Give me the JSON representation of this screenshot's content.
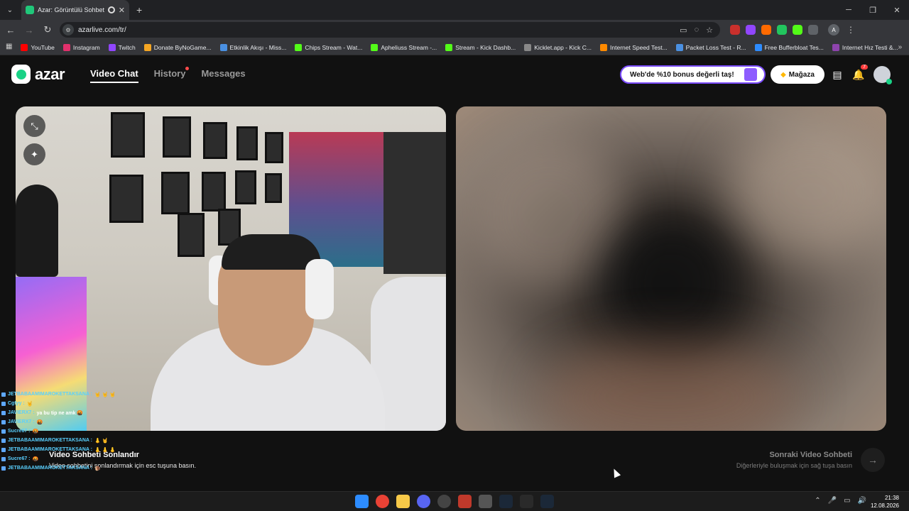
{
  "browser": {
    "tab_title": "Azar: Görüntülü Sohbet & V",
    "url": "azarlive.com/tr/",
    "bookmarks": [
      {
        "label": "YouTube",
        "color": "#ff0000"
      },
      {
        "label": "Instagram",
        "color": "#e1306c"
      },
      {
        "label": "Twitch",
        "color": "#9146ff"
      },
      {
        "label": "Donate ByNoGame...",
        "color": "#f5a623"
      },
      {
        "label": "Etkinlik Akışı - Miss...",
        "color": "#4a90e2"
      },
      {
        "label": "Chips Stream - Wat...",
        "color": "#53fc18"
      },
      {
        "label": "Apheliuss Stream -...",
        "color": "#53fc18"
      },
      {
        "label": "Stream - Kick Dashb...",
        "color": "#53fc18"
      },
      {
        "label": "Kicklet.app - Kick C...",
        "color": "#888888"
      },
      {
        "label": "Internet Speed Test...",
        "color": "#ff8a00"
      },
      {
        "label": "Packet Loss Test - R...",
        "color": "#4a90e2"
      },
      {
        "label": "Free Bufferbloat Tes...",
        "color": "#2d8cff"
      },
      {
        "label": "Internet Hız Testi &...",
        "color": "#8e44ad"
      }
    ],
    "profile_initial": "A"
  },
  "app": {
    "logo": "azar",
    "nav": [
      {
        "label": "Video Chat",
        "active": true
      },
      {
        "label": "History",
        "active": false
      },
      {
        "label": "Messages",
        "active": false
      }
    ],
    "promo": "Web'de %10 bonus değerli taş!",
    "store": "Mağaza",
    "notification_count": "7",
    "end_chat": {
      "title": "Video Sohbeti Sonlandır",
      "subtitle": "Video sohbetini sonlandırmak için esc tuşuna basın."
    },
    "next_chat": {
      "title": "Sonraki Video Sohbeti",
      "subtitle": "Diğerleriyle buluşmak için sağ tuşa basın"
    }
  },
  "chat": [
    {
      "user": "JETBABAAMIMAROKETTAKSANA :",
      "msg": "🤘 🤘 🤘"
    },
    {
      "user": "Cgtyy :",
      "msg": "🤘"
    },
    {
      "user": "JAVIERX7 :",
      "msg": "ya bu tip ne amk 🤬"
    },
    {
      "user": "JAVIERX7 :",
      "msg": "🤬"
    },
    {
      "user": "Sucre67 :",
      "msg": "🤬"
    },
    {
      "user": "JETBABAAMIMAROKETTAKSANA :",
      "msg": "👃 🤘"
    },
    {
      "user": "JETBABAAMIMAROKETTAKSANA :",
      "msg": "👃 👃 👃"
    },
    {
      "user": "Sucre67 :",
      "msg": "🤬"
    },
    {
      "user": "JETBABAAMIMAROKETTAKSANA :",
      "msg": "🐌"
    }
  ],
  "taskbar": {
    "time": "21:38",
    "date": "12.08.2026"
  }
}
